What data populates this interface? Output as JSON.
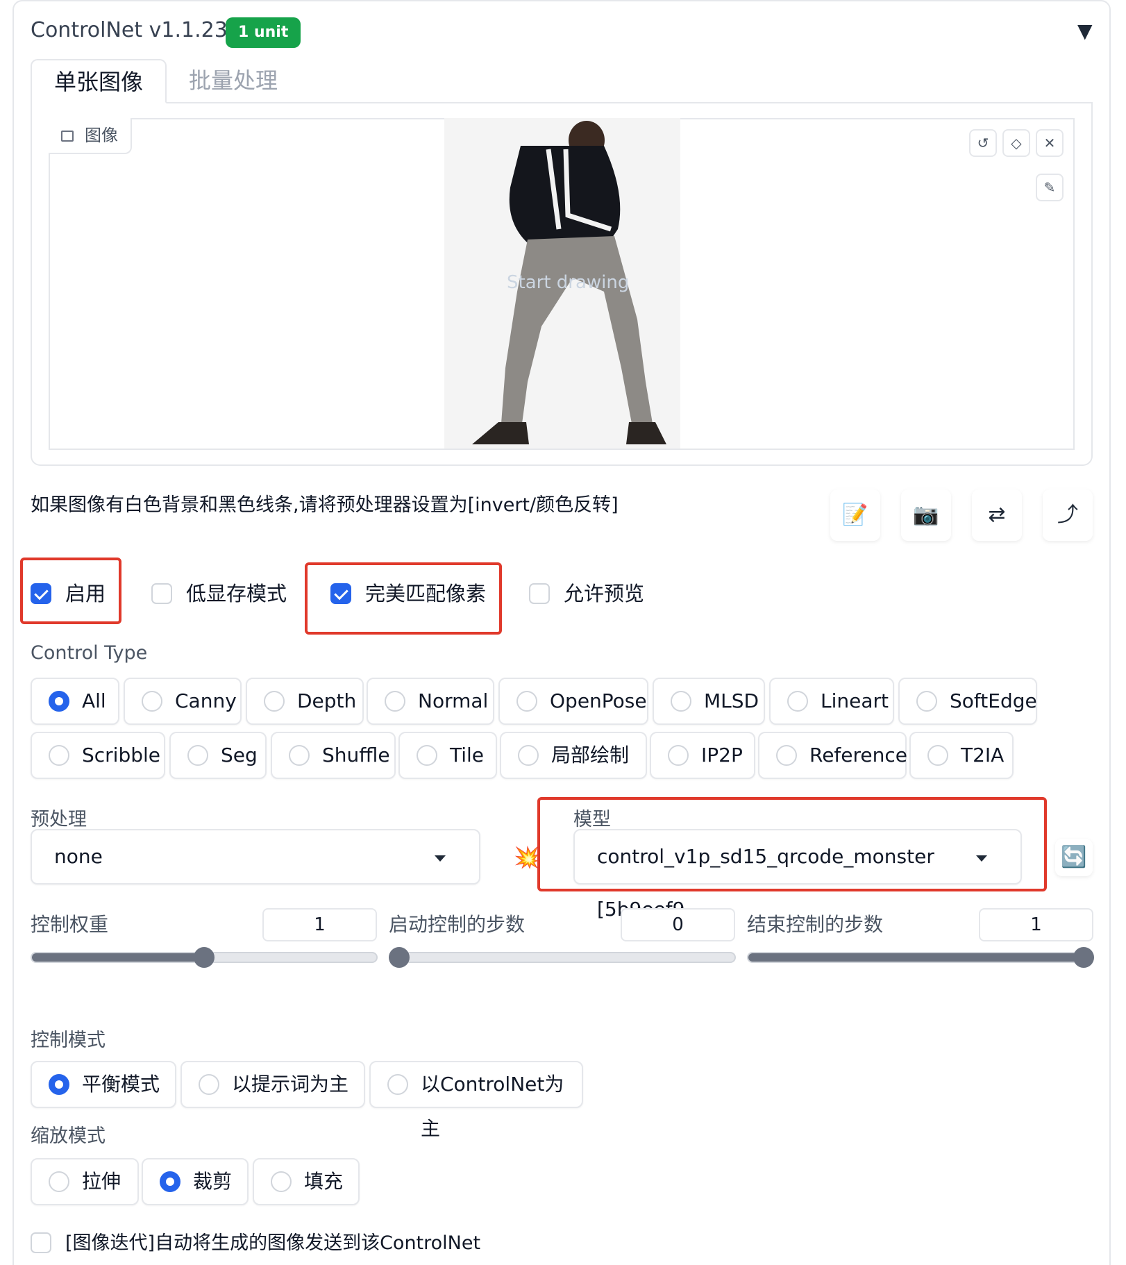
{
  "header": {
    "title": "ControlNet v1.1.232",
    "badge": "1 unit",
    "collapse_glyph": "▼"
  },
  "tabs": [
    {
      "label": "单张图像",
      "active": true
    },
    {
      "label": "批量处理",
      "active": false
    }
  ],
  "image_panel": {
    "label": "图像",
    "placeholder": "Start drawing",
    "icons": [
      "undo-icon",
      "eraser-icon",
      "close-icon",
      "brush-icon"
    ]
  },
  "hint": "如果图像有白色背景和黑色线条,请将预处理器设置为[invert/颜色反转]",
  "action_icons": [
    "📝",
    "📷",
    "⇄",
    "⤴"
  ],
  "options": {
    "enable": {
      "label": "启用",
      "checked": true
    },
    "low_vram": {
      "label": "低显存模式",
      "checked": false
    },
    "pixel_perfect": {
      "label": "完美匹配像素",
      "checked": true
    },
    "allow_preview": {
      "label": "允许预览",
      "checked": false
    }
  },
  "control_type": {
    "label": "Control Type",
    "row1": [
      "All",
      "Canny",
      "Depth",
      "Normal",
      "OpenPose",
      "MLSD",
      "Lineart",
      "SoftEdge"
    ],
    "row2": [
      "Scribble",
      "Seg",
      "Shuffle",
      "Tile",
      "局部绘制",
      "IP2P",
      "Reference",
      "T2IA"
    ],
    "selected": "All"
  },
  "preprocessor": {
    "label": "预处理",
    "value": "none",
    "run_icon": "💥"
  },
  "model": {
    "label": "模型",
    "value": "control_v1p_sd15_qrcode_monster [5b9eef9",
    "refresh_icon": "🔄"
  },
  "sliders": {
    "weight": {
      "label": "控制权重",
      "value": "1",
      "fraction": 0.5
    },
    "start": {
      "label": "启动控制的步数",
      "value": "0",
      "fraction": 0.0
    },
    "end": {
      "label": "结束控制的步数",
      "value": "1",
      "fraction": 1.0
    }
  },
  "control_mode": {
    "label": "控制模式",
    "options": [
      "平衡模式",
      "以提示词为主",
      "以ControlNet为主"
    ],
    "selected": "平衡模式"
  },
  "resize_mode": {
    "label": "缩放模式",
    "options": [
      "拉伸",
      "裁剪",
      "填充"
    ],
    "selected": "裁剪"
  },
  "loopback": {
    "label": "[图像迭代]自动将生成的图像发送到该ControlNet",
    "checked": false
  },
  "colors": {
    "accent": "#2563eb",
    "badge": "#16a34a",
    "highlight": "#e0392b"
  }
}
